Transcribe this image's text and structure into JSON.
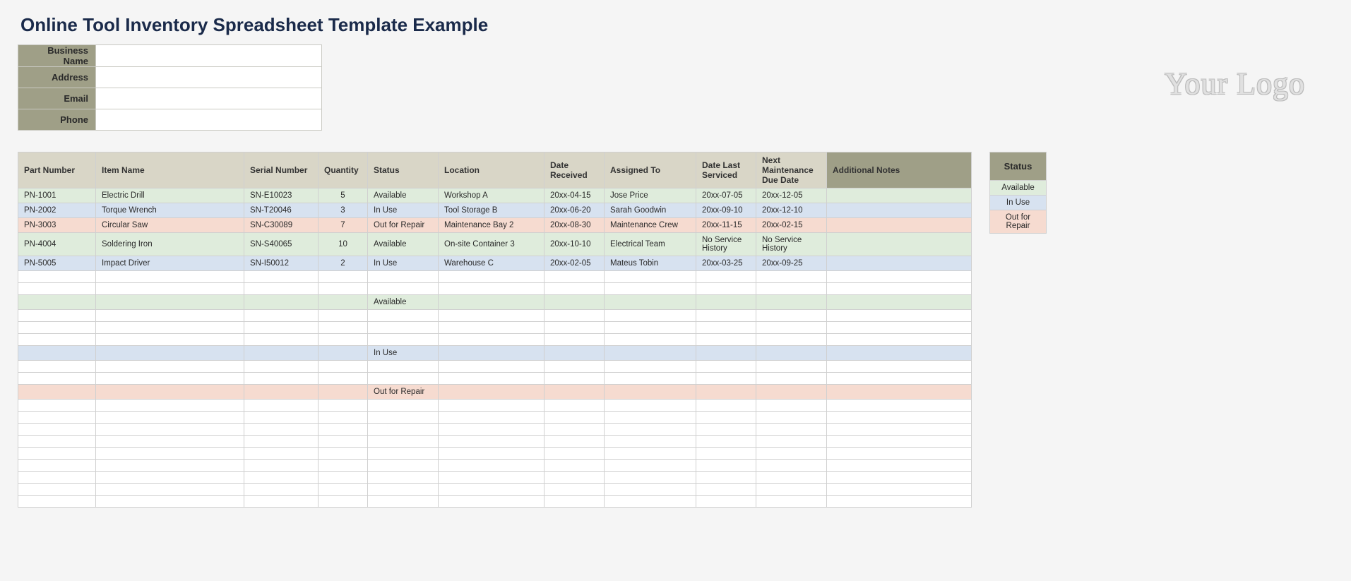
{
  "title": "Online Tool Inventory Spreadsheet Template Example",
  "logo_text": "Your Logo",
  "business_fields": {
    "name_label": "Business Name",
    "address_label": "Address",
    "email_label": "Email",
    "phone_label": "Phone",
    "name": "",
    "address": "",
    "email": "",
    "phone": ""
  },
  "headers": {
    "part_number": "Part Number",
    "item_name": "Item Name",
    "serial_number": "Serial Number",
    "quantity": "Quantity",
    "status": "Status",
    "location": "Location",
    "date_received": "Date Received",
    "assigned_to": "Assigned To",
    "date_last_serviced": "Date Last Serviced",
    "next_maintenance": "Next Maintenance Due Date",
    "notes": "Additional Notes"
  },
  "rows": [
    {
      "status_class": "row-available",
      "part_number": "PN-1001",
      "item_name": "Electric Drill",
      "serial_number": "SN-E10023",
      "quantity": "5",
      "status": "Available",
      "location": "Workshop A",
      "date_received": "20xx-04-15",
      "assigned_to": "Jose Price",
      "date_last_serviced": "20xx-07-05",
      "next_maintenance": "20xx-12-05",
      "notes": ""
    },
    {
      "status_class": "row-inuse",
      "part_number": "PN-2002",
      "item_name": "Torque Wrench",
      "serial_number": "SN-T20046",
      "quantity": "3",
      "status": "In Use",
      "location": "Tool Storage B",
      "date_received": "20xx-06-20",
      "assigned_to": "Sarah Goodwin",
      "date_last_serviced": "20xx-09-10",
      "next_maintenance": "20xx-12-10",
      "notes": ""
    },
    {
      "status_class": "row-repair",
      "part_number": "PN-3003",
      "item_name": "Circular Saw",
      "serial_number": "SN-C30089",
      "quantity": "7",
      "status": "Out for Repair",
      "location": "Maintenance Bay 2",
      "date_received": "20xx-08-30",
      "assigned_to": "Maintenance Crew",
      "date_last_serviced": "20xx-11-15",
      "next_maintenance": "20xx-02-15",
      "notes": ""
    },
    {
      "status_class": "row-available",
      "part_number": "PN-4004",
      "item_name": "Soldering Iron",
      "serial_number": "SN-S40065",
      "quantity": "10",
      "status": "Available",
      "location": "On-site Container 3",
      "date_received": "20xx-10-10",
      "assigned_to": "Electrical Team",
      "date_last_serviced": "No Service History",
      "next_maintenance": "No Service History",
      "notes": ""
    },
    {
      "status_class": "row-inuse",
      "part_number": "PN-5005",
      "item_name": "Impact Driver",
      "serial_number": "SN-I50012",
      "quantity": "2",
      "status": "In Use",
      "location": "Warehouse C",
      "date_received": "20xx-02-05",
      "assigned_to": "Mateus Tobin",
      "date_last_serviced": "20xx-03-25",
      "next_maintenance": "20xx-09-25",
      "notes": ""
    },
    {
      "status_class": "row-blank",
      "part_number": "",
      "item_name": "",
      "serial_number": "",
      "quantity": "",
      "status": "",
      "location": "",
      "date_received": "",
      "assigned_to": "",
      "date_last_serviced": "",
      "next_maintenance": "",
      "notes": ""
    },
    {
      "status_class": "row-blank",
      "part_number": "",
      "item_name": "",
      "serial_number": "",
      "quantity": "",
      "status": "",
      "location": "",
      "date_received": "",
      "assigned_to": "",
      "date_last_serviced": "",
      "next_maintenance": "",
      "notes": ""
    },
    {
      "status_class": "row-available",
      "part_number": "",
      "item_name": "",
      "serial_number": "",
      "quantity": "",
      "status": "Available",
      "location": "",
      "date_received": "",
      "assigned_to": "",
      "date_last_serviced": "",
      "next_maintenance": "",
      "notes": ""
    },
    {
      "status_class": "row-blank",
      "part_number": "",
      "item_name": "",
      "serial_number": "",
      "quantity": "",
      "status": "",
      "location": "",
      "date_received": "",
      "assigned_to": "",
      "date_last_serviced": "",
      "next_maintenance": "",
      "notes": ""
    },
    {
      "status_class": "row-blank",
      "part_number": "",
      "item_name": "",
      "serial_number": "",
      "quantity": "",
      "status": "",
      "location": "",
      "date_received": "",
      "assigned_to": "",
      "date_last_serviced": "",
      "next_maintenance": "",
      "notes": ""
    },
    {
      "status_class": "row-blank",
      "part_number": "",
      "item_name": "",
      "serial_number": "",
      "quantity": "",
      "status": "",
      "location": "",
      "date_received": "",
      "assigned_to": "",
      "date_last_serviced": "",
      "next_maintenance": "",
      "notes": ""
    },
    {
      "status_class": "row-inuse",
      "part_number": "",
      "item_name": "",
      "serial_number": "",
      "quantity": "",
      "status": "In Use",
      "location": "",
      "date_received": "",
      "assigned_to": "",
      "date_last_serviced": "",
      "next_maintenance": "",
      "notes": ""
    },
    {
      "status_class": "row-blank",
      "part_number": "",
      "item_name": "",
      "serial_number": "",
      "quantity": "",
      "status": "",
      "location": "",
      "date_received": "",
      "assigned_to": "",
      "date_last_serviced": "",
      "next_maintenance": "",
      "notes": ""
    },
    {
      "status_class": "row-blank",
      "part_number": "",
      "item_name": "",
      "serial_number": "",
      "quantity": "",
      "status": "",
      "location": "",
      "date_received": "",
      "assigned_to": "",
      "date_last_serviced": "",
      "next_maintenance": "",
      "notes": ""
    },
    {
      "status_class": "row-repair",
      "part_number": "",
      "item_name": "",
      "serial_number": "",
      "quantity": "",
      "status": "Out for Repair",
      "location": "",
      "date_received": "",
      "assigned_to": "",
      "date_last_serviced": "",
      "next_maintenance": "",
      "notes": ""
    },
    {
      "status_class": "row-blank",
      "part_number": "",
      "item_name": "",
      "serial_number": "",
      "quantity": "",
      "status": "",
      "location": "",
      "date_received": "",
      "assigned_to": "",
      "date_last_serviced": "",
      "next_maintenance": "",
      "notes": ""
    },
    {
      "status_class": "row-blank",
      "part_number": "",
      "item_name": "",
      "serial_number": "",
      "quantity": "",
      "status": "",
      "location": "",
      "date_received": "",
      "assigned_to": "",
      "date_last_serviced": "",
      "next_maintenance": "",
      "notes": ""
    },
    {
      "status_class": "row-blank",
      "part_number": "",
      "item_name": "",
      "serial_number": "",
      "quantity": "",
      "status": "",
      "location": "",
      "date_received": "",
      "assigned_to": "",
      "date_last_serviced": "",
      "next_maintenance": "",
      "notes": ""
    },
    {
      "status_class": "row-blank",
      "part_number": "",
      "item_name": "",
      "serial_number": "",
      "quantity": "",
      "status": "",
      "location": "",
      "date_received": "",
      "assigned_to": "",
      "date_last_serviced": "",
      "next_maintenance": "",
      "notes": ""
    },
    {
      "status_class": "row-blank",
      "part_number": "",
      "item_name": "",
      "serial_number": "",
      "quantity": "",
      "status": "",
      "location": "",
      "date_received": "",
      "assigned_to": "",
      "date_last_serviced": "",
      "next_maintenance": "",
      "notes": ""
    },
    {
      "status_class": "row-blank",
      "part_number": "",
      "item_name": "",
      "serial_number": "",
      "quantity": "",
      "status": "",
      "location": "",
      "date_received": "",
      "assigned_to": "",
      "date_last_serviced": "",
      "next_maintenance": "",
      "notes": ""
    },
    {
      "status_class": "row-blank",
      "part_number": "",
      "item_name": "",
      "serial_number": "",
      "quantity": "",
      "status": "",
      "location": "",
      "date_received": "",
      "assigned_to": "",
      "date_last_serviced": "",
      "next_maintenance": "",
      "notes": ""
    },
    {
      "status_class": "row-blank",
      "part_number": "",
      "item_name": "",
      "serial_number": "",
      "quantity": "",
      "status": "",
      "location": "",
      "date_received": "",
      "assigned_to": "",
      "date_last_serviced": "",
      "next_maintenance": "",
      "notes": ""
    },
    {
      "status_class": "row-blank",
      "part_number": "",
      "item_name": "",
      "serial_number": "",
      "quantity": "",
      "status": "",
      "location": "",
      "date_received": "",
      "assigned_to": "",
      "date_last_serviced": "",
      "next_maintenance": "",
      "notes": ""
    }
  ],
  "legend": {
    "header": "Status",
    "items": [
      {
        "label": "Available",
        "class": "row-available"
      },
      {
        "label": "In Use",
        "class": "row-inuse"
      },
      {
        "label": "Out for Repair",
        "class": "row-repair"
      }
    ]
  }
}
